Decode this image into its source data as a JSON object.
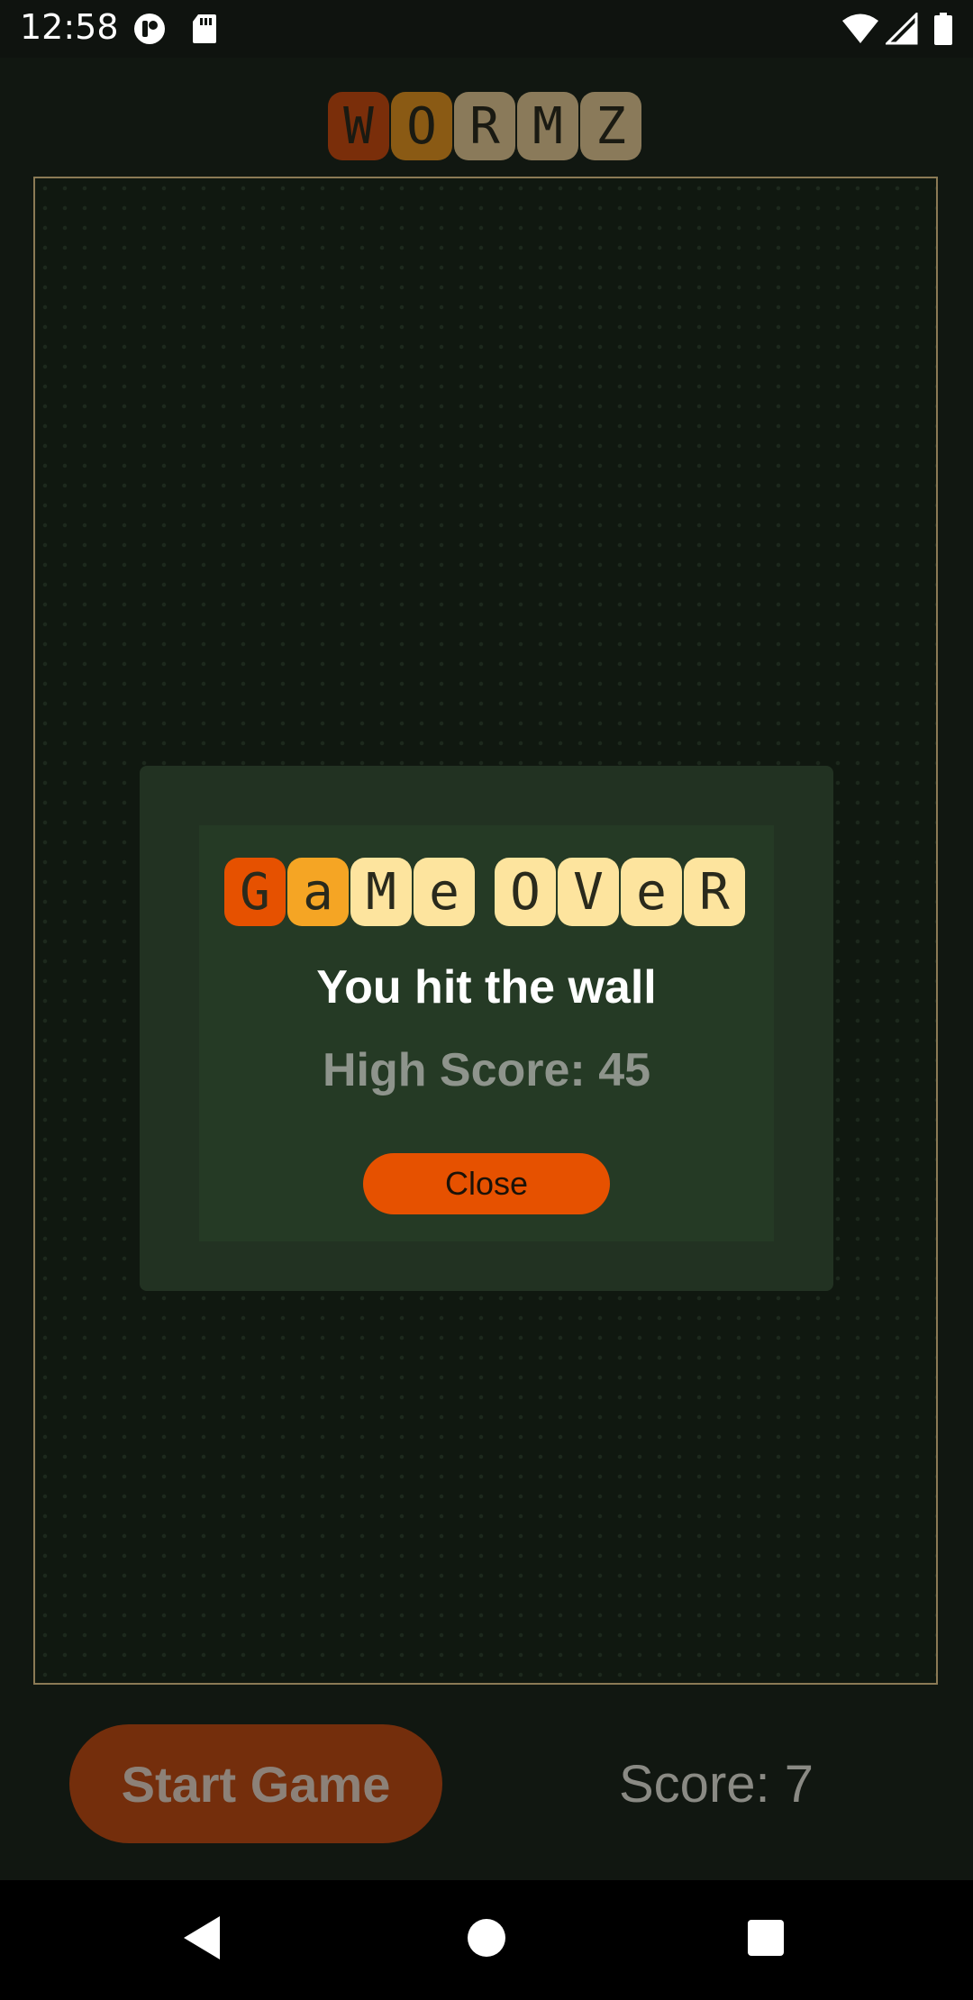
{
  "status_bar": {
    "time": "12:58",
    "icons": [
      "app-notification-icon",
      "sd-card-icon",
      "wifi-icon",
      "signal-icon",
      "battery-icon"
    ]
  },
  "logo": {
    "letters": [
      "W",
      "O",
      "R",
      "M",
      "Z"
    ],
    "tile_colors": [
      "#7a2e0a",
      "#8a5a14",
      "#8a7a5a",
      "#8a7a5a",
      "#8a7a5a"
    ]
  },
  "game_over_dialog": {
    "title_words": [
      {
        "letters": [
          "G",
          "a",
          "M",
          "e"
        ],
        "tile_colors": [
          "#e65100",
          "#f5a524",
          "#fde49e",
          "#fde49e"
        ]
      },
      {
        "letters": [
          "O",
          "V",
          "e",
          "R"
        ],
        "tile_colors": [
          "#fde49e",
          "#fde49e",
          "#fde49e",
          "#fde49e"
        ]
      }
    ],
    "message": "You hit the wall",
    "high_score": "High Score: 45",
    "close_label": "Close"
  },
  "controls": {
    "start_label": "Start Game",
    "score": "Score: 7"
  },
  "nav_bar": {
    "buttons": [
      "back-icon",
      "home-icon",
      "recents-icon"
    ]
  },
  "colors": {
    "background": "#111711",
    "board_border": "#8b7a55",
    "accent": "#e65100",
    "dialog_bg": "#223222"
  }
}
